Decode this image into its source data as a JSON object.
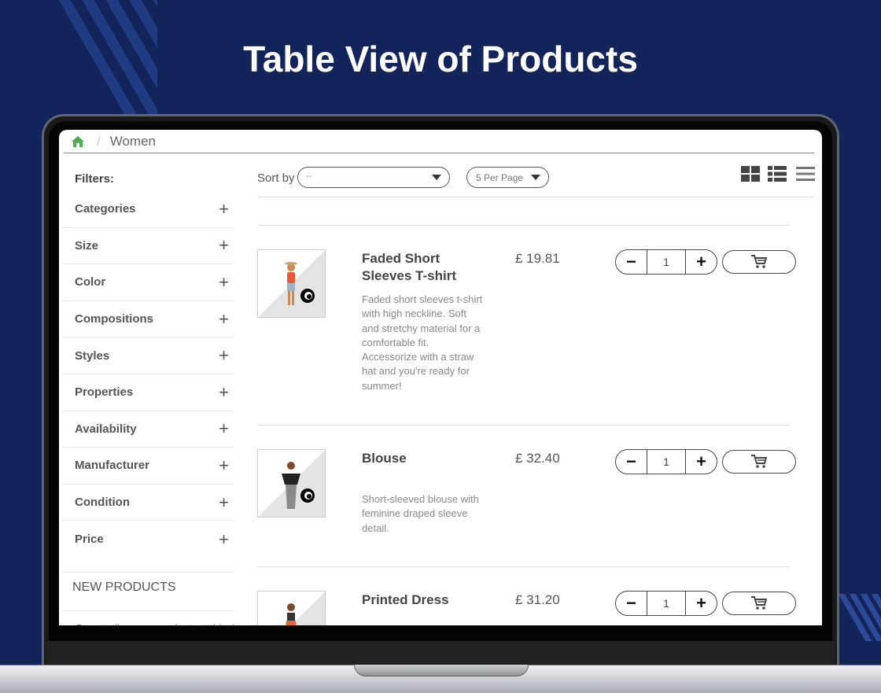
{
  "hero": {
    "title": "Table View of Products"
  },
  "breadcrumb": {
    "separator": "/",
    "current": "Women"
  },
  "sidebar": {
    "filters_title": "Filters:",
    "filters": [
      {
        "label": "Categories",
        "toggle": "+"
      },
      {
        "label": "Size",
        "toggle": "+"
      },
      {
        "label": "Color",
        "toggle": "+"
      },
      {
        "label": "Compositions",
        "toggle": "+"
      },
      {
        "label": "Styles",
        "toggle": "+"
      },
      {
        "label": "Properties",
        "toggle": "+"
      },
      {
        "label": "Availability",
        "toggle": "+"
      },
      {
        "label": "Manufacturer",
        "toggle": "+"
      },
      {
        "label": "Condition",
        "toggle": "+"
      },
      {
        "label": "Price",
        "toggle": "+"
      }
    ],
    "new_products_title": "NEW PRODUCTS",
    "new_products_text": "Do not allow new products at this time."
  },
  "toolbar": {
    "sort_label": "Sort by",
    "sort_value": "--",
    "per_page_value": "5 Per Page",
    "views": [
      "grid-view-icon",
      "list-view-icon",
      "table-view-icon"
    ]
  },
  "products": [
    {
      "name": "Faded Short Sleeves T-shirt",
      "price": "£ 19.81",
      "description": "Faded short sleeves t-shirt with high neckline. Soft and stretchy material for a comfortable fit. Accessorize with a straw hat and you're ready for summer!",
      "quantity": "1",
      "minus": "−",
      "plus": "+"
    },
    {
      "name": "Blouse",
      "price": "£ 32.40",
      "description": "Short-sleeved blouse with feminine draped sleeve detail.",
      "quantity": "1",
      "minus": "−",
      "plus": "+"
    },
    {
      "name": "Printed Dress",
      "price": "£ 31.20",
      "description": "",
      "quantity": "1",
      "minus": "−",
      "plus": "+"
    }
  ],
  "colors": {
    "background": "#13245a",
    "home_icon": "#4cae4c",
    "text_dark": "#444444",
    "text_muted": "#888888"
  }
}
